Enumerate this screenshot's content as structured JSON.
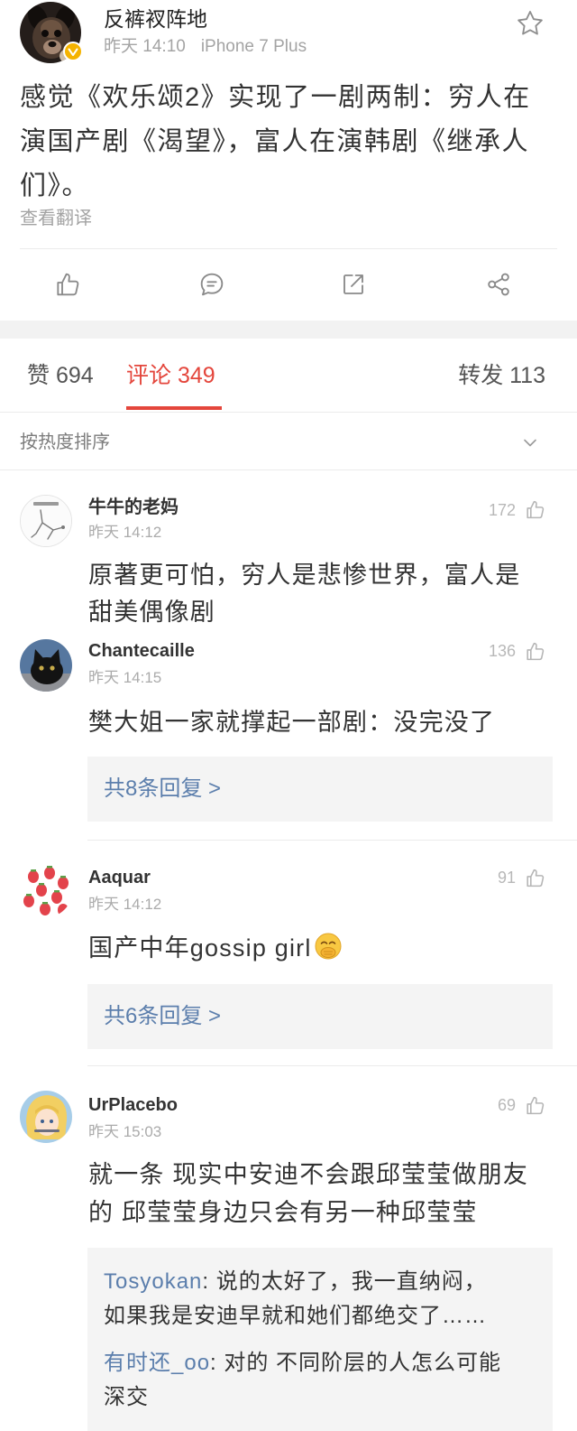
{
  "post": {
    "author_name": "反裤衩阵地",
    "time": "昨天 14:10",
    "source": "iPhone 7 Plus",
    "text_lines": [
      "感觉《欢乐颂2》实现了一剧两制：穷人在",
      "演国产剧《渴望》，富人在演韩剧《继承人",
      "们》。"
    ],
    "translate_label": "查看翻译",
    "icons": {
      "verified": "verified-badge-icon",
      "favorite": "star-icon",
      "like": "like-icon",
      "comment": "comment-icon",
      "repost": "repost-icon",
      "share": "share-icon"
    }
  },
  "tabs": [
    {
      "label": "赞 694",
      "active": false
    },
    {
      "label": "评论 349",
      "active": true
    },
    {
      "label": "转发 113",
      "active": false
    }
  ],
  "sort": {
    "label": "按热度排序",
    "icon": "chevron-down-icon"
  },
  "comments": [
    {
      "user": "牛牛的老妈",
      "time": "昨天 14:12",
      "likes": "172",
      "like_icon": "thumbs-up-icon",
      "text_lines": [
        "原著更可怕，穷人是悲惨世界，富人是",
        "甜美偶像剧"
      ]
    },
    {
      "user": "Chantecaille",
      "time": "昨天 14:15",
      "likes": "136",
      "like_icon": "thumbs-up-icon",
      "text_lines": [
        "樊大姐一家就撑起一部剧：没完没了"
      ],
      "more_replies": "共8条回复 >"
    },
    {
      "user": "Aaquar",
      "time": "昨天 14:12",
      "likes": "91",
      "like_icon": "thumbs-up-icon",
      "text_lines": [
        "国产中年gossip girl"
      ],
      "emoji": "giggle-emoji-icon",
      "more_replies": "共6条回复 >"
    },
    {
      "user": "UrPlacebo",
      "time": "昨天 15:03",
      "likes": "69",
      "like_icon": "thumbs-up-icon",
      "text_lines": [
        "就一条 现实中安迪不会跟邱莹莹做朋友",
        "的 邱莹莹身边只会有另一种邱莹莹"
      ],
      "replies": [
        {
          "user": "Tosyokan",
          "text_lines": [
            ": 说的太好了，我一直纳闷，",
            "如果我是安迪早就和她们都绝交了……"
          ]
        },
        {
          "user": "有时还_oo",
          "text_lines": [
            ": 对的 不同阶层的人怎么可能",
            "深交"
          ]
        }
      ]
    }
  ],
  "colors": {
    "accent": "#e4463c",
    "link": "#5b7eac",
    "verified": "#f5b300",
    "reply_background": "#f4f4f4",
    "section_separator": "#f2f2f2"
  }
}
